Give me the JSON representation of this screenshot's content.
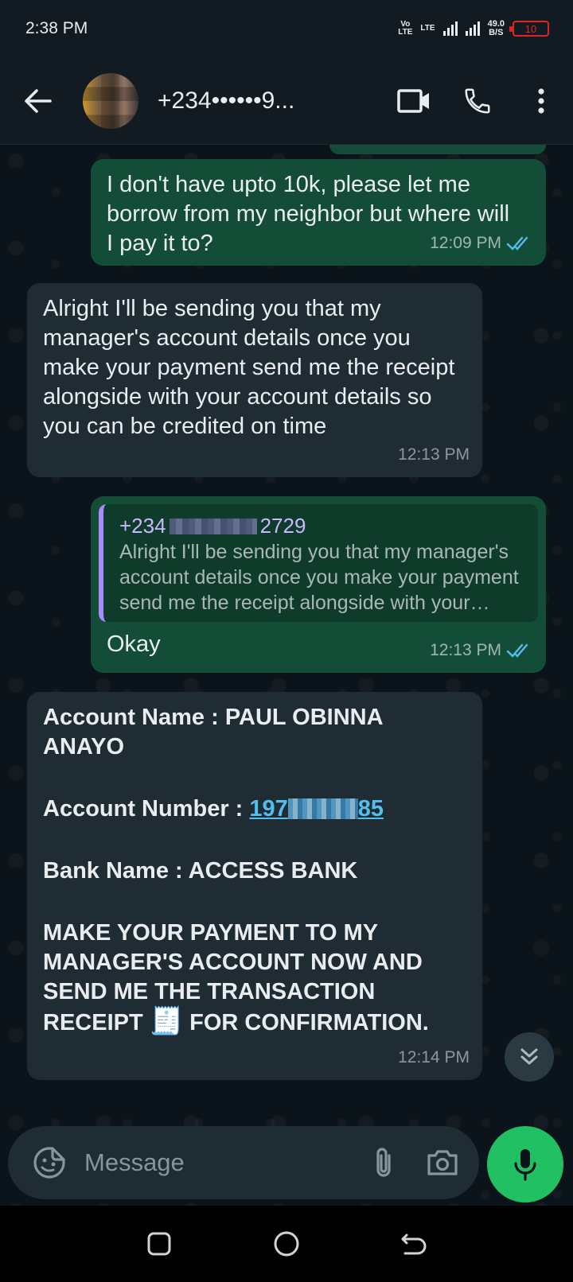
{
  "status_bar": {
    "time": "2:38 PM",
    "volte": "Vo\nLTE",
    "lte": "LTE",
    "speed_value": "49.0",
    "speed_unit": "B/S",
    "battery": "10"
  },
  "header": {
    "contact": "+234••••••9...",
    "icons": [
      "back-arrow-icon",
      "video-call-icon",
      "phone-icon",
      "more-vert-icon"
    ]
  },
  "messages": [
    {
      "direction": "out",
      "text": "I don't have upto 10k, please let me borrow from my neighbor but where will I pay it to?",
      "time": "12:09 PM",
      "status": "read"
    },
    {
      "direction": "in",
      "text": "Alright I'll be sending you that my manager's account details once you make your payment send me the receipt alongside with your account details so you can be credited on time",
      "time": "12:13 PM"
    },
    {
      "direction": "out",
      "quote_name_prefix": "+234",
      "quote_name_suffix": "2729",
      "quote_text": "Alright I'll be sending you that my manager's account details once you make your payment send me the receipt alongside with your account details so you can be credited on time",
      "text": "Okay",
      "time": "12:13 PM",
      "status": "read"
    },
    {
      "direction": "in",
      "account_name": "Account Name : PAUL OBINNA ANAYO",
      "account_number_label": "Account Number : ",
      "account_number_start": "197",
      "account_number_end": "85",
      "bank_name": "Bank Name : ACCESS BANK",
      "instruction_part1": "MAKE YOUR PAYMENT TO MY MANAGER'S ACCOUNT NOW AND SEND ME THE TRANSACTION RECEIPT",
      "instruction_emoji": "🧾",
      "instruction_part2": "FOR CONFIRMATION.",
      "time": "12:14 PM"
    }
  ],
  "composer": {
    "placeholder": "Message"
  },
  "colors": {
    "outgoing_bubble": "#144d37",
    "incoming_bubble": "#202c33",
    "read_ticks": "#53bdeb",
    "mic_button": "#21c063"
  }
}
